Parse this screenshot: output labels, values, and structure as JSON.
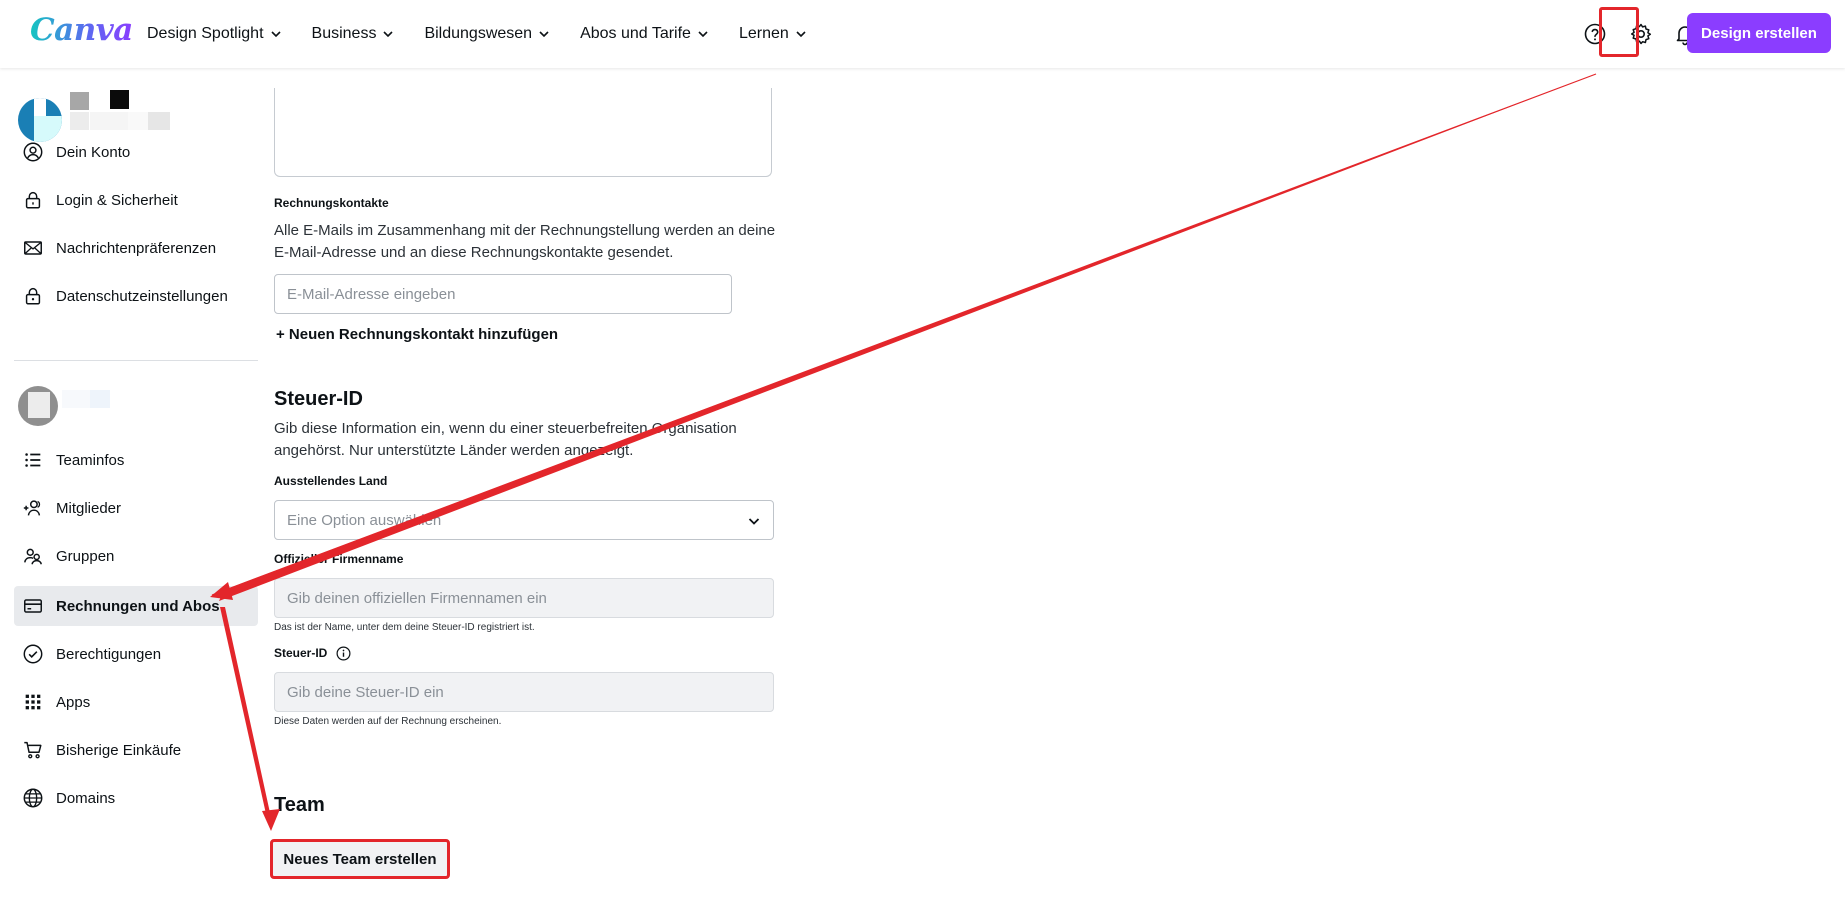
{
  "topbar": {
    "logo": "Canva",
    "nav": [
      {
        "label": "Design Spotlight"
      },
      {
        "label": "Business"
      },
      {
        "label": "Bildungswesen"
      },
      {
        "label": "Abos und Tarife"
      },
      {
        "label": "Lernen"
      }
    ],
    "create_button": "Design erstellen",
    "accent_color": "#8b3dff",
    "icons": [
      "help-icon",
      "gear-icon",
      "bell-icon"
    ]
  },
  "sidebar": {
    "account_items": [
      {
        "label": "Dein Konto",
        "icon": "user-circle-icon"
      },
      {
        "label": "Login & Sicherheit",
        "icon": "lock-icon"
      },
      {
        "label": "Nachrichtenpräferenzen",
        "icon": "envelope-icon"
      },
      {
        "label": "Datenschutzeinstellungen",
        "icon": "privacy-lock-icon"
      }
    ],
    "team_items": [
      {
        "label": "Teaminfos",
        "icon": "list-icon"
      },
      {
        "label": "Mitglieder",
        "icon": "add-people-icon"
      },
      {
        "label": "Gruppen",
        "icon": "group-icon"
      },
      {
        "label": "Rechnungen und Abos",
        "icon": "credit-card-icon",
        "active": true
      },
      {
        "label": "Berechtigungen",
        "icon": "check-circle-icon"
      },
      {
        "label": "Apps",
        "icon": "apps-grid-icon"
      },
      {
        "label": "Bisherige Einkäufe",
        "icon": "cart-icon"
      },
      {
        "label": "Domains",
        "icon": "globe-icon"
      }
    ]
  },
  "billing": {
    "contacts_label": "Rechnungskontakte",
    "contacts_desc_1": "Alle E-Mails im Zusammenhang mit der Rechnungstellung werden an deine",
    "contacts_desc_2": "E-Mail-Adresse und an diese Rechnungskontakte gesendet.",
    "email_placeholder": "E-Mail-Adresse eingeben",
    "add_contact": "+ Neuen Rechnungskontakt hinzufügen"
  },
  "tax": {
    "heading": "Steuer-ID",
    "desc_1": "Gib diese Information ein, wenn du einer steuerbefreiten Organisation",
    "desc_2": "angehörst. Nur unterstützte Länder werden angezeigt.",
    "country_label": "Ausstellendes Land",
    "country_placeholder": "Eine Option auswählen",
    "company_label": "Offizieller Firmenname",
    "company_placeholder": "Gib deinen offiziellen Firmennamen ein",
    "company_hint": "Das ist der Name, unter dem deine Steuer-ID registriert ist.",
    "taxid_label": "Steuer-ID",
    "taxid_placeholder": "Gib deine Steuer-ID ein",
    "taxid_hint": "Diese Daten werden auf der Rechnung erscheinen."
  },
  "team": {
    "heading": "Team",
    "create_button": "Neues Team erstellen"
  },
  "annotation_color": "#e3262b"
}
